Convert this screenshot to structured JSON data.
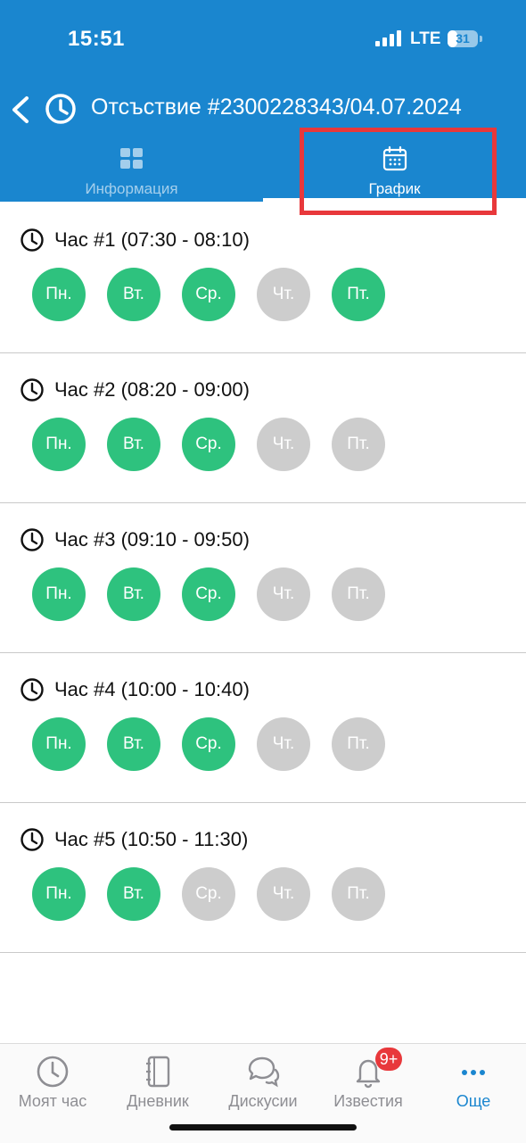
{
  "status_bar": {
    "time": "15:51",
    "network": "LTE",
    "battery": "31",
    "battery_level": 0.31
  },
  "header": {
    "title": "Отсъствие #2300228343/04.07.2024",
    "tabs": [
      {
        "label": "Информация",
        "icon": "grid-icon",
        "active": false
      },
      {
        "label": "График",
        "icon": "calendar-icon",
        "active": true
      }
    ]
  },
  "colors": {
    "primary": "#1a86cf",
    "present": "#2ec27e",
    "absent": "#cdcdcd",
    "highlight": "#e8383b"
  },
  "periods": [
    {
      "title": "Час #1 (07:30 - 08:10)",
      "days": [
        {
          "label": "Пн.",
          "active": true
        },
        {
          "label": "Вт.",
          "active": true
        },
        {
          "label": "Ср.",
          "active": true
        },
        {
          "label": "Чт.",
          "active": false
        },
        {
          "label": "Пт.",
          "active": true
        }
      ]
    },
    {
      "title": "Час #2 (08:20 - 09:00)",
      "days": [
        {
          "label": "Пн.",
          "active": true
        },
        {
          "label": "Вт.",
          "active": true
        },
        {
          "label": "Ср.",
          "active": true
        },
        {
          "label": "Чт.",
          "active": false
        },
        {
          "label": "Пт.",
          "active": false
        }
      ]
    },
    {
      "title": "Час #3 (09:10 - 09:50)",
      "days": [
        {
          "label": "Пн.",
          "active": true
        },
        {
          "label": "Вт.",
          "active": true
        },
        {
          "label": "Ср.",
          "active": true
        },
        {
          "label": "Чт.",
          "active": false
        },
        {
          "label": "Пт.",
          "active": false
        }
      ]
    },
    {
      "title": "Час #4 (10:00 - 10:40)",
      "days": [
        {
          "label": "Пн.",
          "active": true
        },
        {
          "label": "Вт.",
          "active": true
        },
        {
          "label": "Ср.",
          "active": true
        },
        {
          "label": "Чт.",
          "active": false
        },
        {
          "label": "Пт.",
          "active": false
        }
      ]
    },
    {
      "title": "Час #5 (10:50 - 11:30)",
      "days": [
        {
          "label": "Пн.",
          "active": true
        },
        {
          "label": "Вт.",
          "active": true
        },
        {
          "label": "Ср.",
          "active": false
        },
        {
          "label": "Чт.",
          "active": false
        },
        {
          "label": "Пт.",
          "active": false
        }
      ]
    }
  ],
  "bottom_nav": [
    {
      "label": "Моят час",
      "icon": "clock-icon",
      "active": false
    },
    {
      "label": "Дневник",
      "icon": "notebook-icon",
      "active": false
    },
    {
      "label": "Дискусии",
      "icon": "chat-bubbles-icon",
      "active": false
    },
    {
      "label": "Известия",
      "icon": "bell-icon",
      "active": false,
      "badge": "9+"
    },
    {
      "label": "Още",
      "icon": "more-dots-icon",
      "active": true
    }
  ]
}
